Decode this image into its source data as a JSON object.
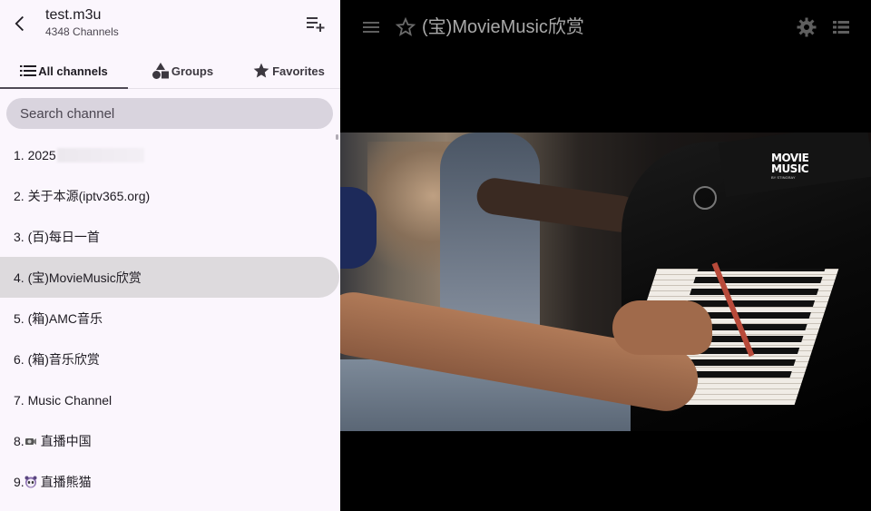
{
  "sidebar": {
    "title": "test.m3u",
    "subtitle": "4348 Channels",
    "tabs": [
      {
        "label": "All channels",
        "icon": "list-icon"
      },
      {
        "label": "Groups",
        "icon": "shapes-icon"
      },
      {
        "label": "Favorites",
        "icon": "star-icon"
      }
    ],
    "search_placeholder": "Search channel",
    "channels": [
      {
        "label": "1. 2025"
      },
      {
        "label": "2. 关于本源(iptv365.org)"
      },
      {
        "label": "3. (百)每日一首"
      },
      {
        "label": "4. (宝)MovieMusic欣赏"
      },
      {
        "label": "5. (箱)AMC音乐"
      },
      {
        "label": "6. (箱)音乐欣赏"
      },
      {
        "label": "7. Music Channel"
      },
      {
        "label": "8. ",
        "suffix": "直播中国",
        "icon": "camera-emoji"
      },
      {
        "label": "9. ",
        "suffix": "直播熊猫",
        "icon": "panda-emoji"
      }
    ],
    "selected_index": 3
  },
  "player": {
    "title": "(宝)MovieMusic欣赏",
    "logo_line1": "MOVIE",
    "logo_line2": "MUSIC",
    "logo_sub": "BY STINGRAY"
  },
  "colors": {
    "sidebar_bg": "#fbf6fd",
    "search_bg": "#d9d4de",
    "selected_bg": "#dddadd",
    "icon_gray": "#5f5f5f"
  }
}
